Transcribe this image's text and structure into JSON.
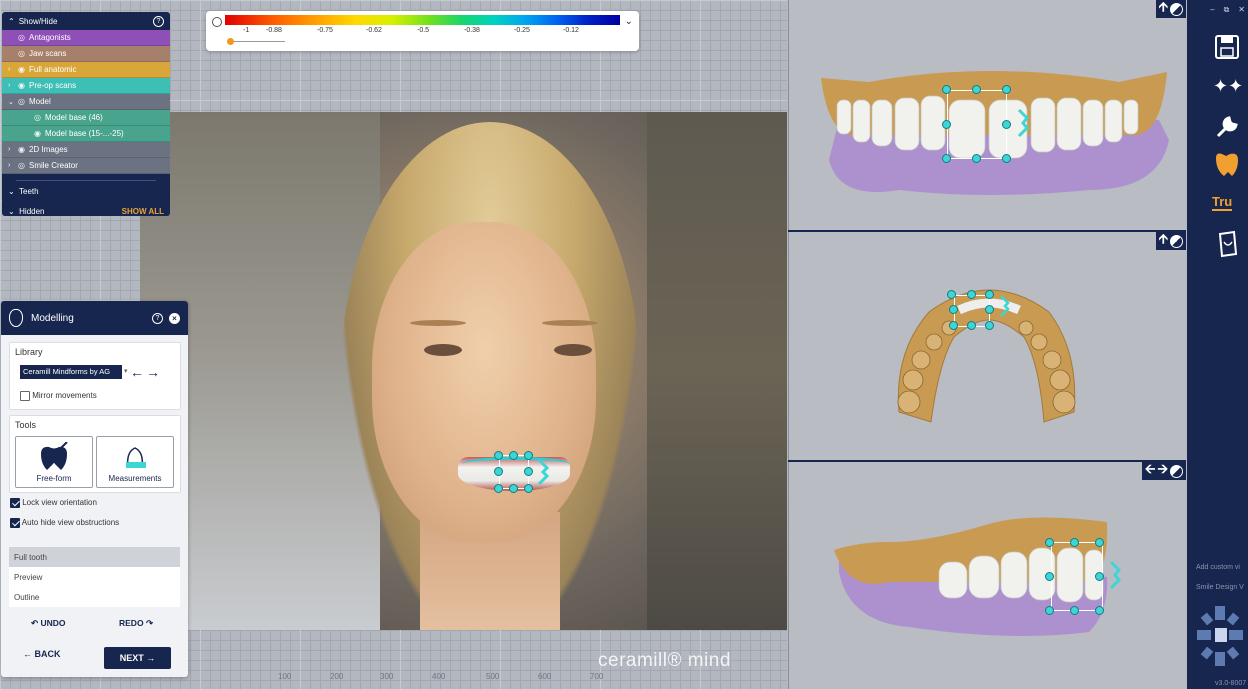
{
  "colorscale": {
    "ticks": [
      "-1",
      "-0.88",
      "-0.75",
      "-0.62",
      "-0.5",
      "-0.38",
      "-0.25",
      "-0.12"
    ]
  },
  "showhide": {
    "title": "Show/Hide",
    "layers": [
      {
        "label": "Antagonists",
        "color": "#8e4fb7"
      },
      {
        "label": "Jaw scans",
        "color": "#a6806a"
      },
      {
        "label": "Full anatomic",
        "color": "#d9a63a"
      },
      {
        "label": "Pre-op scans",
        "color": "#3dbfb5"
      },
      {
        "label": "Model",
        "color": "#6b7282"
      },
      {
        "label": "Model base (46)",
        "color": "#48a48c"
      },
      {
        "label": "Model base (15-...-25)",
        "color": "#48a48c"
      },
      {
        "label": "2D Images",
        "color": "#6b7282"
      },
      {
        "label": "Smile Creator",
        "color": "#6b7282"
      }
    ],
    "teeth_label": "Teeth",
    "hidden_label": "Hidden",
    "show_all_label": "SHOW ALL"
  },
  "modelling": {
    "title": "Modelling",
    "library_label": "Library",
    "library_value": "Ceramill Mindforms by AG",
    "mirror_label": "Mirror movements",
    "tools_label": "Tools",
    "tool_freeform": "Free-form",
    "tool_measurements": "Measurements",
    "lock_view_label": "Lock view orientation",
    "auto_hide_label": "Auto hide view obstructions",
    "modes": [
      "Full tooth",
      "Preview",
      "Outline"
    ],
    "undo_label": "UNDO",
    "redo_label": "REDO",
    "back_label": "BACK",
    "next_label": "NEXT"
  },
  "ruler": [
    "100",
    "200",
    "300",
    "400",
    "500",
    "600",
    "700"
  ],
  "watermark": "ceramill® mind",
  "rightbar": {
    "custom_view_label": "Add custom vi",
    "smile_design_label": "Smile Design V",
    "tru_label": "Tru",
    "version": "v3.0-8007"
  }
}
